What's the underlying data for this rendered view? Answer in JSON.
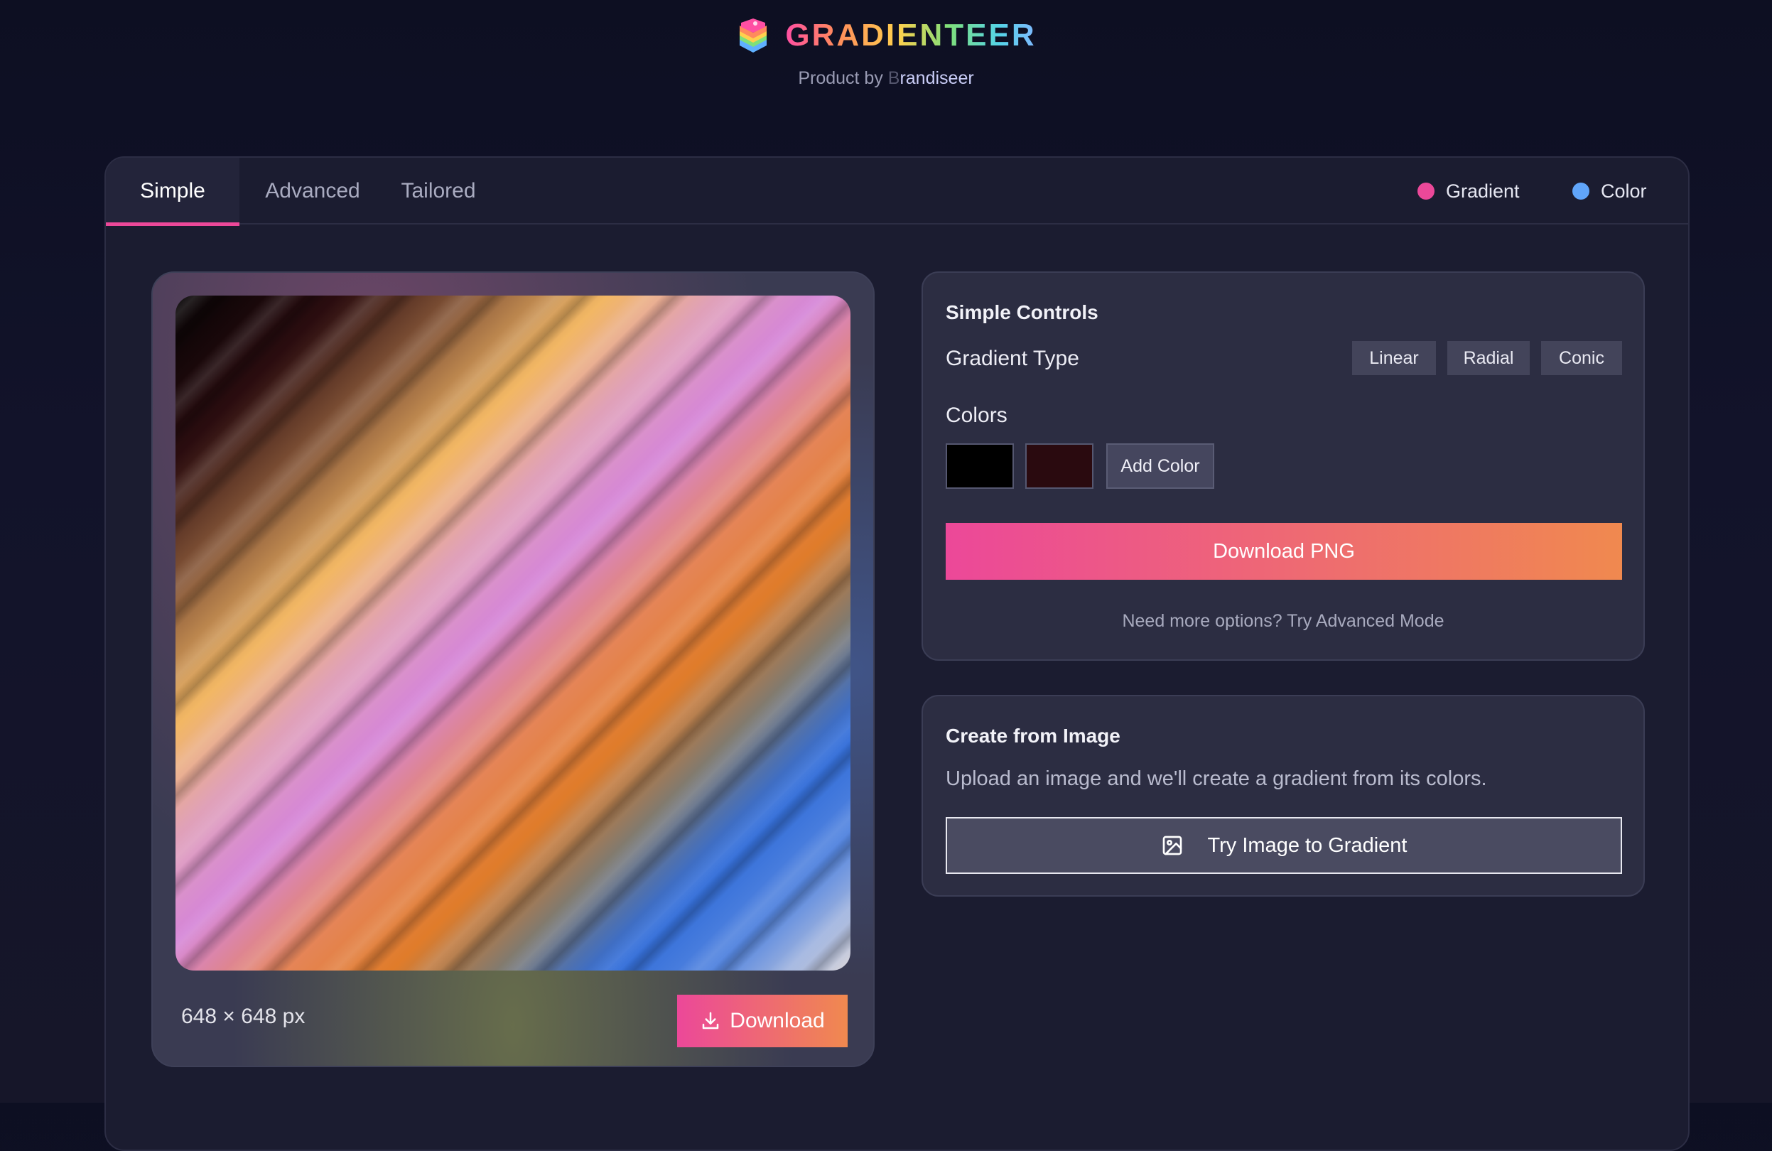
{
  "header": {
    "title": "GRADIENTEER",
    "byline_prefix": "Product by ",
    "brand_first": "B",
    "brand_rest": "randiseer"
  },
  "tabs": [
    {
      "label": "Simple",
      "active": true
    },
    {
      "label": "Advanced",
      "active": false
    },
    {
      "label": "Tailored",
      "active": false
    }
  ],
  "modes": [
    {
      "label": "Gradient",
      "color": "#ec4899"
    },
    {
      "label": "Color",
      "color": "#60a5fa"
    }
  ],
  "preview": {
    "dimensions": "648 × 648 px",
    "download_label": "Download"
  },
  "simple_controls": {
    "title": "Simple Controls",
    "gradient_type_label": "Gradient Type",
    "types": [
      "Linear",
      "Radial",
      "Conic"
    ],
    "colors_label": "Colors",
    "swatches": [
      "#000000",
      "#2a0a0f"
    ],
    "add_color_label": "Add Color",
    "download_png_label": "Download PNG",
    "hint": "Need more options? Try Advanced Mode"
  },
  "image_card": {
    "title": "Create from Image",
    "description": "Upload an image and we'll create a gradient from its colors.",
    "button_label": "Try Image to Gradient"
  },
  "colors": {
    "accent_pink": "#ec4899",
    "accent_orange": "#f0894f"
  }
}
